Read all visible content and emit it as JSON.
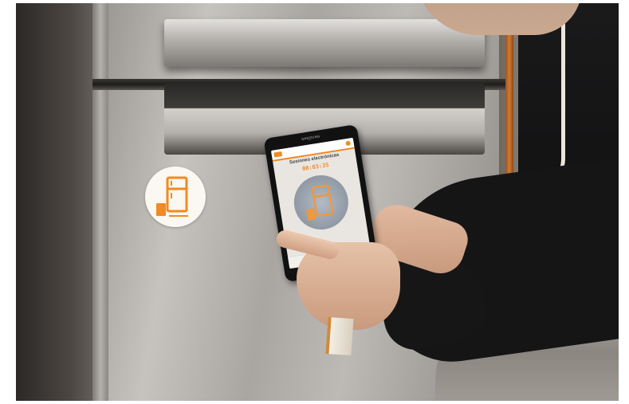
{
  "photo": {
    "description_alt": "",
    "tablet": {
      "brand_text": "SAMSUNG",
      "app_title": "Sesiones electrónicas",
      "timer": "00:03:35"
    },
    "colors": {
      "accent_orange": "#f08a24",
      "steel": "#a6a39f"
    },
    "icons": [
      "fridge-sticker-icon",
      "fridge-app-icon"
    ]
  }
}
